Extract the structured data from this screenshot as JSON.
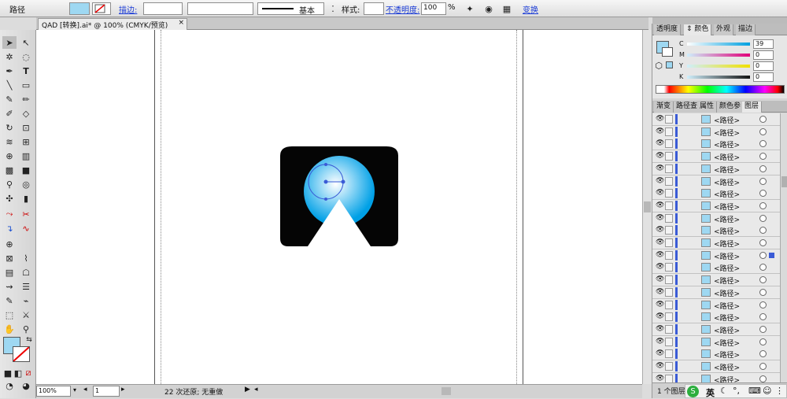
{
  "control_bar": {
    "object_type": "路径",
    "stroke_label": "描边:",
    "brush_label": "基本",
    "style_label": "样式:",
    "opacity_label": "不透明度:",
    "opacity_value": "100",
    "opacity_unit": "%",
    "transform_label": "变换"
  },
  "document_tab": {
    "title": "QAD [转换].ai* @ 100% (CMYK/预览)",
    "close": "×"
  },
  "color_panel": {
    "tabs": [
      "透明度",
      "颜色",
      "外观",
      "描边"
    ],
    "active_tab": "颜色",
    "channels": [
      {
        "name": "C",
        "value": "39",
        "color": "#00a0e0"
      },
      {
        "name": "M",
        "value": "0",
        "color": "#e0007a"
      },
      {
        "name": "Y",
        "value": "0",
        "color": "#f0e000"
      },
      {
        "name": "K",
        "value": "0",
        "color": "#222222"
      }
    ],
    "fill_color": "#9ed8f2"
  },
  "layers_panel": {
    "tabs": [
      "渐变",
      "路径查",
      "属性",
      "颜色参",
      "图层"
    ],
    "active_tab": "图层",
    "row_label": "<路径>",
    "selected_row_index": 11,
    "footer_text": "1 个图层"
  },
  "status_bar": {
    "zoom": "100%",
    "page": "1",
    "message": "22 次还原; 无重做"
  },
  "ime": {
    "label": "英"
  },
  "icons": [
    "selection-icon",
    "direct-selection-icon",
    "magic-wand-icon",
    "lasso-icon",
    "pen-icon",
    "type-icon",
    "line-icon",
    "rectangle-icon",
    "paintbrush-icon",
    "pencil-icon",
    "blob-brush-icon",
    "eraser-icon",
    "rotate-icon",
    "scale-icon",
    "warp-icon",
    "free-transform-icon",
    "shape-builder-icon",
    "perspective-icon",
    "mesh-icon",
    "gradient-icon",
    "eyedropper-icon",
    "blend-icon",
    "symbol-sprayer-icon",
    "column-graph-icon",
    "artboard-icon",
    "slice-icon",
    "hand-icon",
    "zoom-icon"
  ]
}
